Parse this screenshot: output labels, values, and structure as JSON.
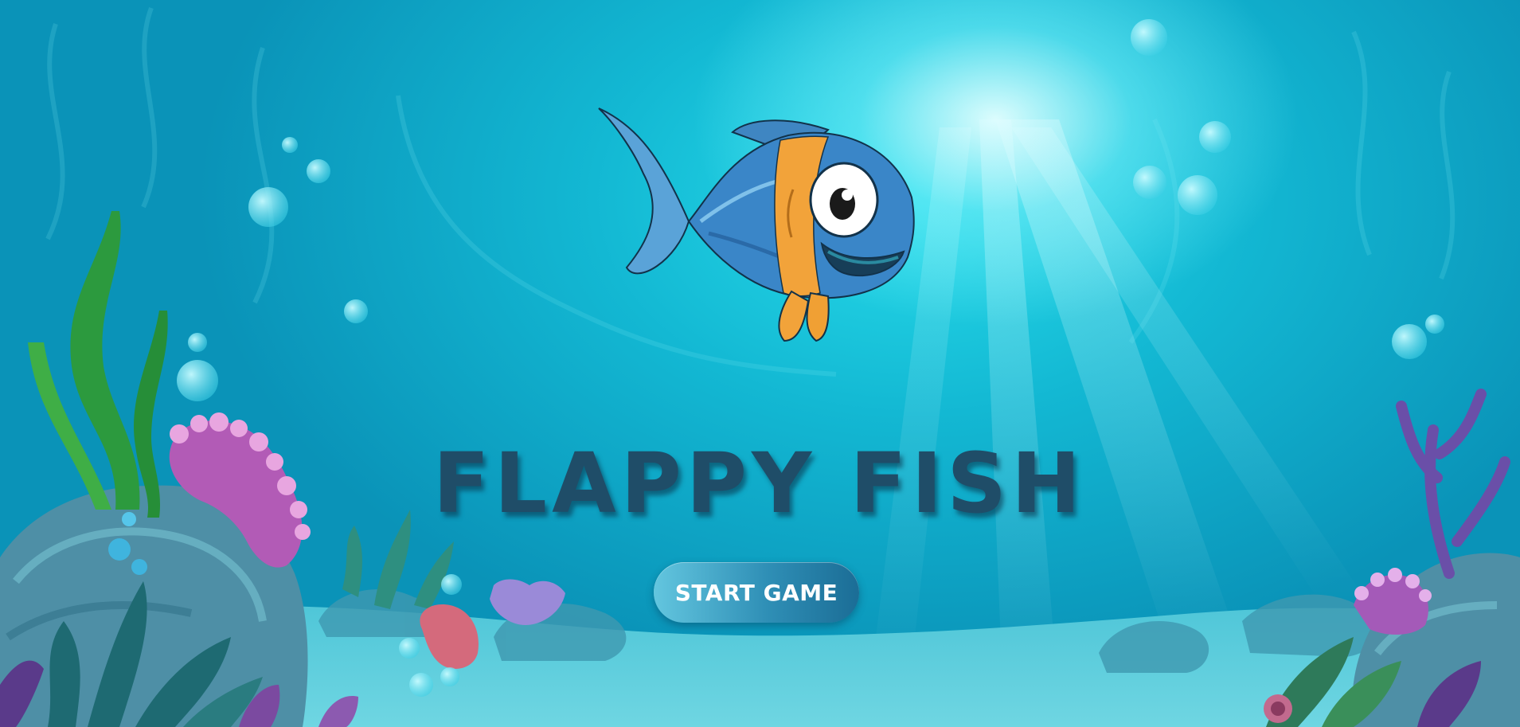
{
  "game": {
    "title": "FLAPPY FISH",
    "start_button_label": "START GAME"
  },
  "icons": {
    "player": "fish-icon",
    "decor": [
      "seaweed-icon",
      "coral-icon",
      "bubble-icon",
      "rock-icon"
    ]
  },
  "colors": {
    "water_light": "#27dcea",
    "water_deep": "#0a93b8",
    "title": "#1f4d68",
    "button_start": "#63c6df",
    "button_end": "#1b6d96",
    "fish_body": "#3a86c8",
    "fish_stripe": "#f2a33a"
  }
}
